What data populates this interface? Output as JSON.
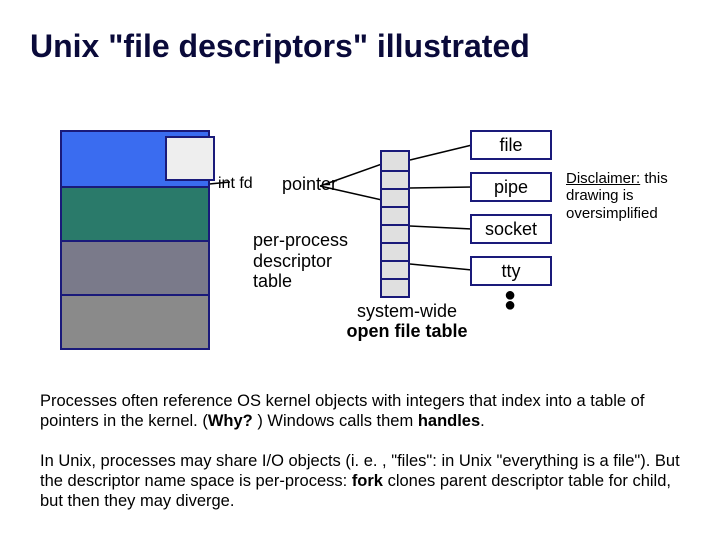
{
  "title": "Unix \"file descriptors\" illustrated",
  "diagram": {
    "int_fd": "int fd",
    "pointer": "pointer",
    "per_process": "per-process descriptor table",
    "system_open_a": "system-wide",
    "system_open_b": "open file table",
    "objects": {
      "file": "file",
      "pipe": "pipe",
      "socket": "socket",
      "tty": "tty"
    },
    "disclaimer_label": "Disclaimer:",
    "disclaimer_text": " this drawing is oversimplified"
  },
  "para1_a": "Processes often reference OS kernel objects with integers that index into a table of pointers in the kernel.  (",
  "para1_why": "Why? ",
  "para1_b": ")  Windows calls them ",
  "para1_handles": "handles",
  "para1_c": ".",
  "para2_a": "In Unix, processes may share I/O objects (i. e. , \"files\": in Unix \"everything is a file\").  But the descriptor name space is per-process: ",
  "para2_fork": "fork",
  "para2_b": " clones parent descriptor table for child, but then they may diverge."
}
